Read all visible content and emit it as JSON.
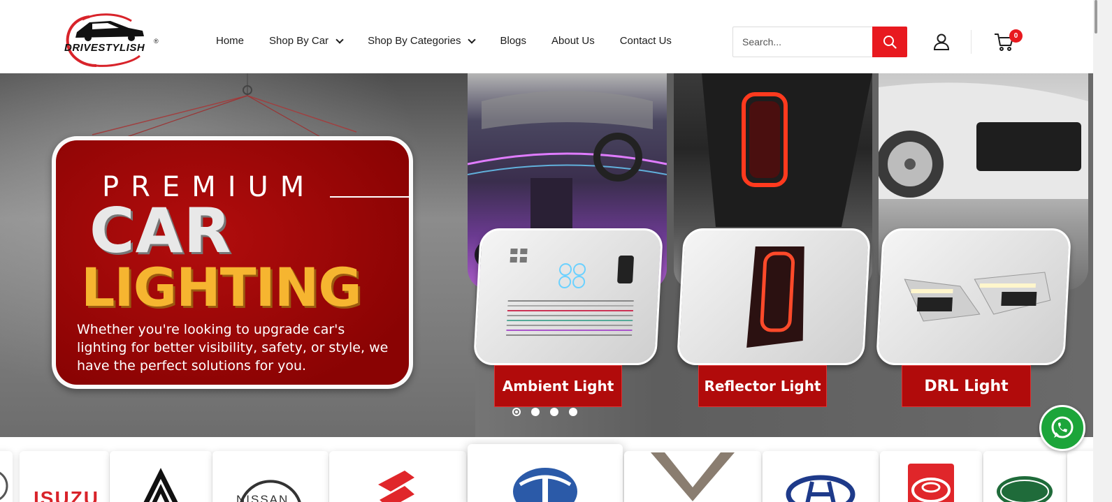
{
  "brand": {
    "name": "DRIVESTYLISH",
    "registered_mark": "®"
  },
  "nav": {
    "items": [
      {
        "label": "Home",
        "has_dropdown": false
      },
      {
        "label": "Shop By Car",
        "has_dropdown": true
      },
      {
        "label": "Shop By Categories",
        "has_dropdown": true
      },
      {
        "label": "Blogs",
        "has_dropdown": false
      },
      {
        "label": "About Us",
        "has_dropdown": false
      },
      {
        "label": "Contact Us",
        "has_dropdown": false
      }
    ]
  },
  "search": {
    "placeholder": "Search...",
    "value": "",
    "icon": "search-icon"
  },
  "header_icons": {
    "account": "user-icon",
    "cart": "cart-icon"
  },
  "cart": {
    "count": "0"
  },
  "hero": {
    "promo": {
      "pretitle": "PREMIUM",
      "title_line1": "CAR",
      "title_line2": "LIGHTING",
      "description": "Whether you're looking to upgrade car's lighting for better visibility, safety, or style, we have the perfect solutions for you."
    },
    "products": [
      {
        "label": "Ambient Light"
      },
      {
        "label": "Reflector Light"
      },
      {
        "label": "DRL Light"
      }
    ],
    "slides": {
      "count": 4,
      "active_index": 0
    }
  },
  "brands": [
    "Isuzu",
    "Citroen",
    "Nissan",
    "Suzuki",
    "Tata",
    "MG",
    "Hyundai",
    "Toyota",
    "Land Rover"
  ],
  "brand_texts": {
    "isuzu": "ISUZU",
    "nissan": "NISSAN"
  },
  "colors": {
    "accent": "#e8191f",
    "promo_red": "#a30707",
    "promo_gold": "#f6b530",
    "whatsapp": "#1ca53a"
  }
}
